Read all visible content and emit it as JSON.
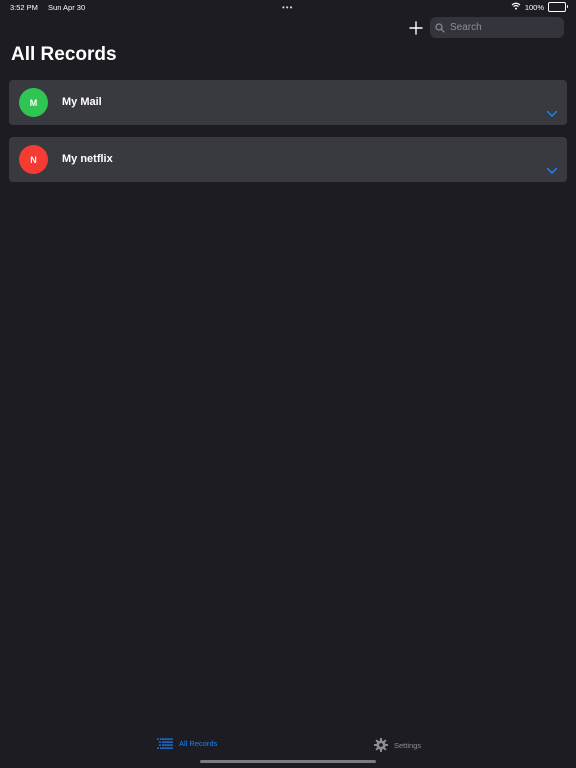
{
  "status_bar": {
    "time": "3:52 PM",
    "date": "Sun Apr 30",
    "dots": "•••",
    "battery": "100%"
  },
  "toolbar": {
    "add_icon": "plus-icon",
    "search_placeholder": "Search",
    "search_value": ""
  },
  "page": {
    "title": "All Records"
  },
  "records": [
    {
      "initial": "M",
      "name": "My Mail",
      "color": "#30c552"
    },
    {
      "initial": "N",
      "name": "My netflix",
      "color": "#f53b32"
    }
  ],
  "tabs": [
    {
      "label": "All Records",
      "icon": "list-icon",
      "active": true
    },
    {
      "label": "Settings",
      "icon": "gear-icon",
      "active": false
    }
  ],
  "colors": {
    "accent": "#1a84ff",
    "background": "#1c1c22",
    "card": "#393940"
  }
}
